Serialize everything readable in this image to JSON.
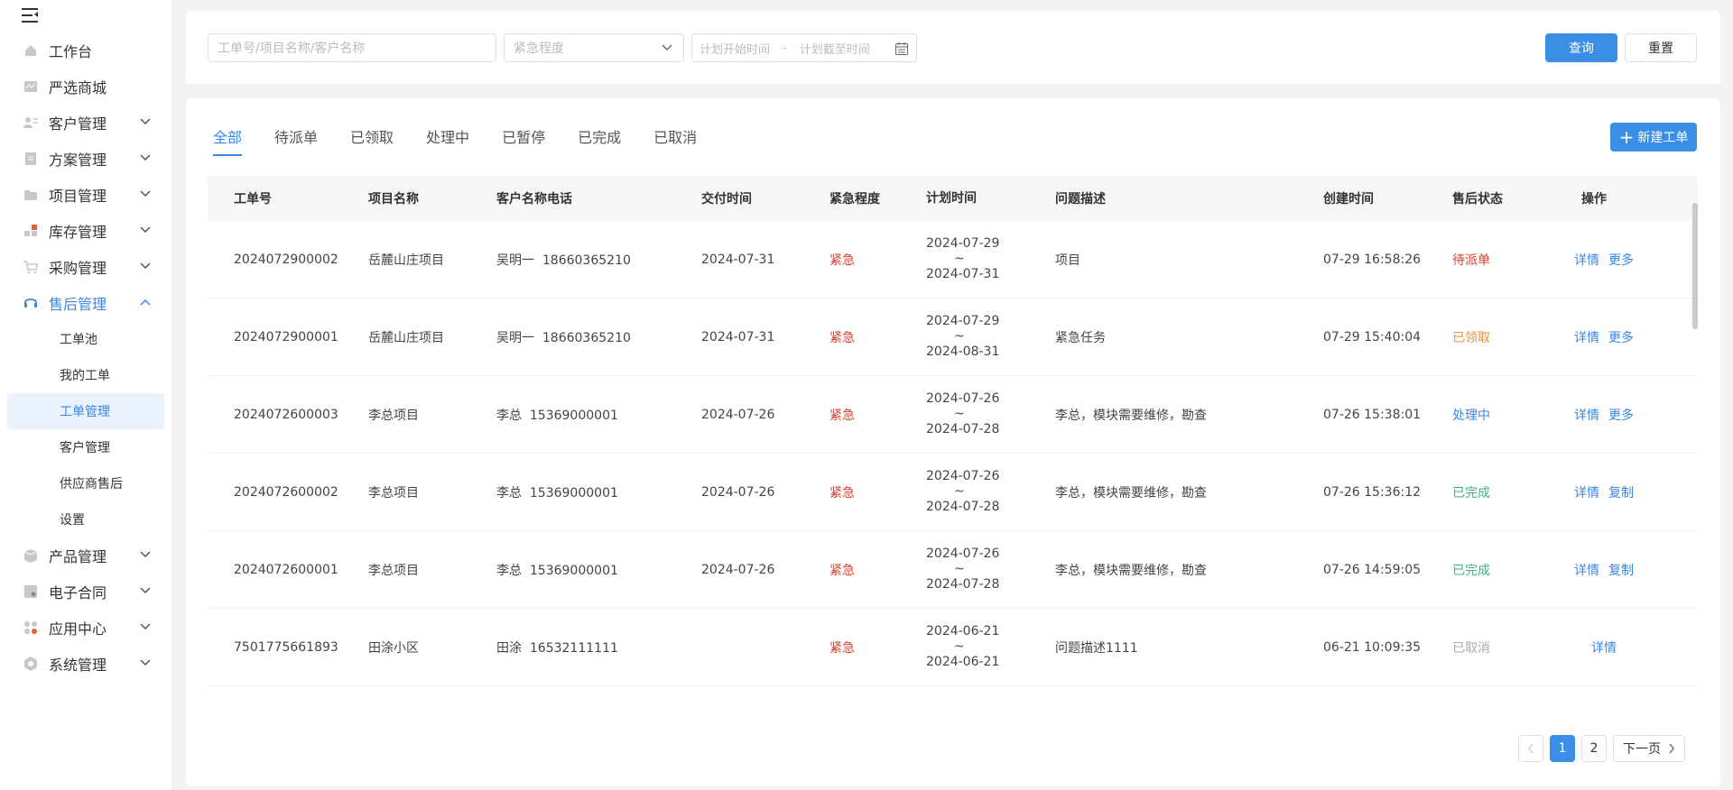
{
  "sidebar": {
    "toggle_icon": "menu-fold-icon",
    "items": [
      {
        "label": "工作台",
        "icon": "home-icon"
      },
      {
        "label": "严选商城",
        "icon": "mall-icon"
      },
      {
        "label": "客户管理",
        "icon": "customer-icon"
      },
      {
        "label": "方案管理",
        "icon": "plan-icon"
      },
      {
        "label": "项目管理",
        "icon": "folder-icon"
      },
      {
        "label": "库存管理",
        "icon": "inventory-icon"
      },
      {
        "label": "采购管理",
        "icon": "cart-icon"
      },
      {
        "label": "售后管理",
        "icon": "headset-icon"
      },
      {
        "label": "产品管理",
        "icon": "box-icon"
      },
      {
        "label": "电子合同",
        "icon": "contract-icon"
      },
      {
        "label": "应用中心",
        "icon": "apps-icon"
      },
      {
        "label": "系统管理",
        "icon": "settings-icon"
      }
    ],
    "aftersales_sub": [
      "工单池",
      "我的工单",
      "工单管理",
      "客户管理",
      "供应商售后",
      "设置"
    ]
  },
  "filter": {
    "search_placeholder": "工单号/项目名称/客户名称",
    "urgency_placeholder": "紧急程度",
    "start_placeholder": "计划开始时间",
    "separator": "-",
    "end_placeholder": "计划截至时间",
    "query_label": "查询",
    "reset_label": "重置"
  },
  "tabs": [
    "全部",
    "待派单",
    "已领取",
    "处理中",
    "已暂停",
    "已完成",
    "已取消"
  ],
  "new_order_label": "新建工单",
  "table": {
    "headers": [
      "工单号",
      "项目名称",
      "客户名称电话",
      "交付时间",
      "紧急程度",
      "计划时间",
      "问题描述",
      "创建时间",
      "售后状态",
      "操作"
    ],
    "rows": [
      {
        "id": "2024072900002",
        "project": "岳麓山庄项目",
        "customer": "吴明一  18660365210",
        "delivery": "2024-07-31",
        "urgency": "紧急",
        "plan_start": "2024-07-29",
        "plan_tilde": "~",
        "plan_end": "2024-07-31",
        "desc": "项目",
        "created": "07-29 16:58:26",
        "status": "待派单",
        "status_color": "red",
        "ops": [
          "详情",
          "更多"
        ]
      },
      {
        "id": "2024072900001",
        "project": "岳麓山庄项目",
        "customer": "吴明一  18660365210",
        "delivery": "2024-07-31",
        "urgency": "紧急",
        "plan_start": "2024-07-29",
        "plan_tilde": "~",
        "plan_end": "2024-08-31",
        "desc": "紧急任务",
        "created": "07-29 15:40:04",
        "status": "已领取",
        "status_color": "orange",
        "ops": [
          "详情",
          "更多"
        ]
      },
      {
        "id": "2024072600003",
        "project": "李总项目",
        "customer": "李总  15369000001",
        "delivery": "2024-07-26",
        "urgency": "紧急",
        "plan_start": "2024-07-26",
        "plan_tilde": "~",
        "plan_end": "2024-07-28",
        "desc": "李总，模块需要维修，勘查",
        "created": "07-26 15:38:01",
        "status": "处理中",
        "status_color": "blue",
        "ops": [
          "详情",
          "更多"
        ]
      },
      {
        "id": "2024072600002",
        "project": "李总项目",
        "customer": "李总  15369000001",
        "delivery": "2024-07-26",
        "urgency": "紧急",
        "plan_start": "2024-07-26",
        "plan_tilde": "~",
        "plan_end": "2024-07-28",
        "desc": "李总，模块需要维修，勘查",
        "created": "07-26 15:36:12",
        "status": "已完成",
        "status_color": "green",
        "ops": [
          "详情",
          "复制"
        ]
      },
      {
        "id": "2024072600001",
        "project": "李总项目",
        "customer": "李总  15369000001",
        "delivery": "2024-07-26",
        "urgency": "紧急",
        "plan_start": "2024-07-26",
        "plan_tilde": "~",
        "plan_end": "2024-07-28",
        "desc": "李总，模块需要维修，勘查",
        "created": "07-26 14:59:05",
        "status": "已完成",
        "status_color": "green",
        "ops": [
          "详情",
          "复制"
        ]
      },
      {
        "id": "7501775661893",
        "project": "田涂小区",
        "customer": "田涂  16532111111",
        "delivery": "",
        "urgency": "紧急",
        "plan_start": "2024-06-21",
        "plan_tilde": "~",
        "plan_end": "2024-06-21",
        "desc": "问题描述1111",
        "created": "06-21 10:09:35",
        "status": "已取消",
        "status_color": "gray",
        "ops": [
          "详情"
        ]
      }
    ]
  },
  "pagination": {
    "pages": [
      "1",
      "2"
    ],
    "current": "1",
    "next_label": "下一页"
  },
  "colors": {
    "accent": "#3a8ee6",
    "urgent": "#e03c2a"
  }
}
